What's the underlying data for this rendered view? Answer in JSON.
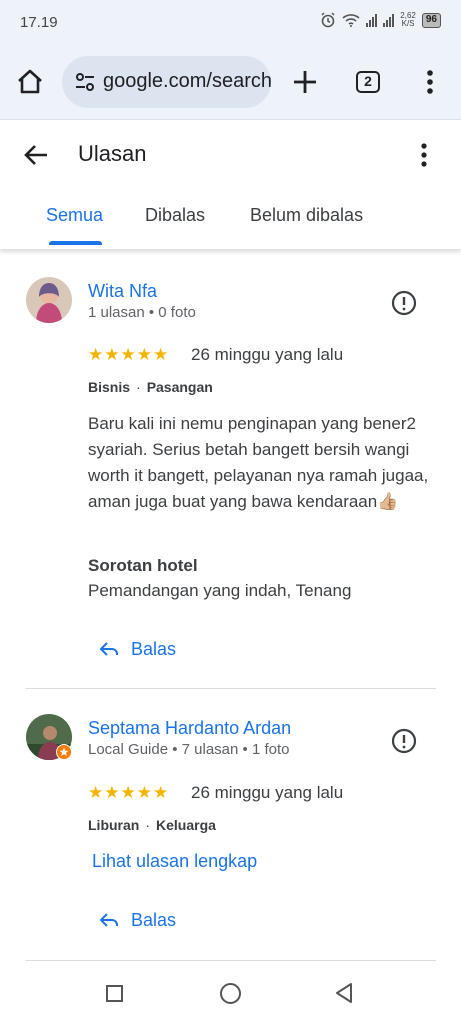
{
  "status_bar": {
    "time": "17.19",
    "net_speed": "2,62",
    "net_unit": "K/S",
    "battery": "96"
  },
  "browser": {
    "url": "google.com/search",
    "tab_count": "2"
  },
  "header": {
    "title": "Ulasan",
    "tabs": [
      {
        "label": "Semua",
        "active": true
      },
      {
        "label": "Dibalas",
        "active": false
      },
      {
        "label": "Belum dibalas",
        "active": false
      }
    ]
  },
  "reviews": [
    {
      "name": "Wita Nfa",
      "meta": "1 ulasan • 0 foto",
      "stars": "★★★★★",
      "rating": 5,
      "date": "26 minggu yang lalu",
      "tags": [
        "Bisnis",
        "Pasangan"
      ],
      "text": "Baru kali ini nemu penginapan yang bener2 syariah. Serius betah bangett bersih wangi worth it bangett, pelayanan nya ramah jugaa, aman juga buat yang bawa kendaraan👍🏼",
      "highlight_title": "Sorotan hotel",
      "highlight_text": "Pemandangan yang indah, Tenang",
      "reply_label": "Balas"
    },
    {
      "name": "Septama Hardanto Ardan",
      "meta": "Local Guide • 7 ulasan • 1 foto",
      "stars": "★★★★★",
      "rating": 5,
      "date": "26 minggu yang lalu",
      "tags": [
        "Liburan",
        "Keluarga"
      ],
      "full_review_link": "Lihat ulasan lengkap",
      "reply_label": "Balas"
    }
  ],
  "colors": {
    "accent": "#1a73e8",
    "star": "#f4b400",
    "browser_bg": "#eef3f9"
  }
}
